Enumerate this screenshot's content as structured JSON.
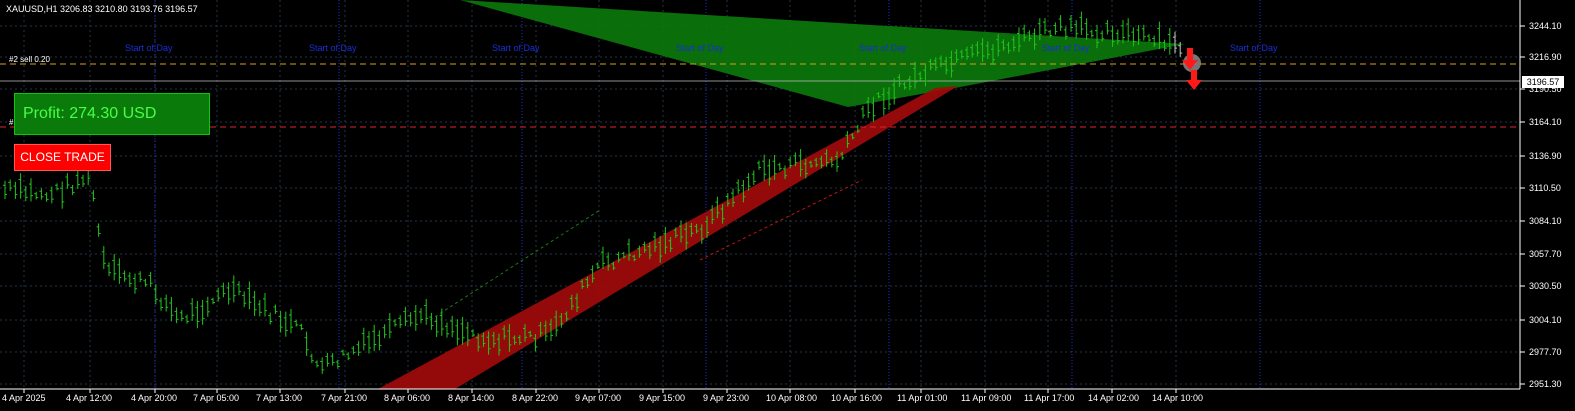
{
  "header": {
    "symbol_line": "XAUUSD,H1  3206.83 3210.80 3193.76 3196.57"
  },
  "trade_tags": {
    "sell_tag": "#2 sell 0.20",
    "tp_tag": "#2 tp"
  },
  "profit_panel": {
    "label": "Profit: 274.30 USD"
  },
  "close_button": {
    "label": "CLOSE TRADE"
  },
  "current_price": "3196.57",
  "price_axis": [
    "3244.10",
    "3216.90",
    "3190.50",
    "3164.10",
    "3136.90",
    "3110.50",
    "3084.10",
    "3057.70",
    "3030.50",
    "3004.10",
    "2977.70",
    "2951.30"
  ],
  "time_axis": [
    "4 Apr 2025",
    "4 Apr 12:00",
    "4 Apr 20:00",
    "7 Apr 05:00",
    "7 Apr 13:00",
    "7 Apr 21:00",
    "8 Apr 06:00",
    "8 Apr 14:00",
    "8 Apr 22:00",
    "9 Apr 07:00",
    "9 Apr 15:00",
    "9 Apr 23:00",
    "10 Apr 08:00",
    "10 Apr 16:00",
    "11 Apr 01:00",
    "11 Apr 09:00",
    "11 Apr 17:00",
    "14 Apr 02:00",
    "14 Apr 10:00"
  ],
  "session_label": "Start of Day",
  "colors": {
    "background": "#000000",
    "grid": "#2a3a4a",
    "bull_candle": "#22c51c",
    "green_zone": "#0b7a0b",
    "red_zone": "#a40a0a",
    "entry_line": "#d4a017",
    "tp_line": "#d4282a",
    "day_separator": "#1a2fd6",
    "profit_bg": "#0a7a0a",
    "profit_text": "#47ff47",
    "close_bg": "#ff0000"
  },
  "icons": {
    "sell_arrow": "down-arrow-icon",
    "trade_marker": "circle-marker-icon"
  }
}
